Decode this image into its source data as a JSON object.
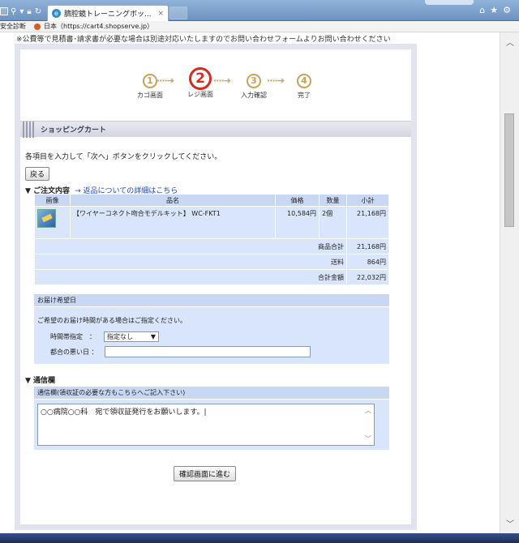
{
  "browser": {
    "tab_title": "臍腔鏡トレーニングボッ...",
    "tab_close": "×",
    "security_label": "安全診断",
    "address": "日本（https://cart4.shopserve.jp）",
    "icons": [
      "home-icon",
      "star-icon",
      "gear-icon"
    ]
  },
  "page": {
    "notice": "※公費等で見積書･請求書が必要な場合は別途対応いたしますのでお問い合わせフォームよりお問い合わせください",
    "steps": [
      {
        "num": "1",
        "label": "カゴ画面"
      },
      {
        "num": "2",
        "label": "レジ画面"
      },
      {
        "num": "3",
        "label": "入力確認"
      },
      {
        "num": "4",
        "label": "完了"
      }
    ],
    "arrow": "····➔",
    "section_title": "ショッピングカート",
    "instruction": "各項目を入力して「次へ」ボタンをクリックしてください。",
    "back_button": "戻る",
    "order_heading": "▼ ご注文内容",
    "returns_link": "→ 返品についての詳細はこちら",
    "table": {
      "headers": [
        "画像",
        "品名",
        "価格",
        "数量",
        "小計"
      ],
      "item": {
        "name": "【ワイヤーコネクト吻合モデルキット】 WC-FKT1",
        "price": "10,584円",
        "qty": "2個",
        "subtotal": "21,168円"
      },
      "summary": [
        {
          "label": "商品合計",
          "value": "21,168円"
        },
        {
          "label": "送料",
          "value": "864円"
        },
        {
          "label": "合計金額",
          "value": "22,032円"
        }
      ]
    },
    "delivery": {
      "title": "お届け希望日",
      "description": "ご希望のお届け時間がある場合はご指定ください。",
      "time_label": "時間帯指定　：",
      "time_value": "指定なし",
      "bad_day_label": "都合の悪い日 ："
    },
    "comments": {
      "heading": "▼ 通信欄",
      "title": "通信欄(領収証の必要な方もこちらへご記入下さい)",
      "value": "○○病院○○科　宛で領収証発行をお願いします。|"
    },
    "confirm_button": "確認画面に進む"
  }
}
